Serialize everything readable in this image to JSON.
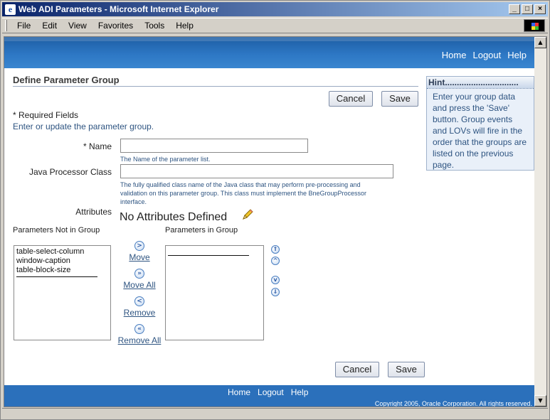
{
  "window": {
    "title": "Web ADI Parameters - Microsoft Internet Explorer",
    "controls": [
      "_",
      "□",
      "×"
    ]
  },
  "menu": [
    "File",
    "Edit",
    "View",
    "Favorites",
    "Tools",
    "Help"
  ],
  "global_links": [
    "Home",
    "Logout",
    "Help"
  ],
  "page": {
    "title": "Define Parameter Group",
    "cancel_label": "Cancel",
    "save_label": "Save",
    "required_note": "* Required Fields",
    "instruction": "Enter or update the parameter group."
  },
  "form": {
    "name_label": "* Name",
    "name_value": "",
    "name_tip": "The Name of the parameter list.",
    "java_label": "Java Processor Class",
    "java_value": "",
    "java_tip_1": "The fully qualified class name of the Java class that may perform pre-processing and",
    "java_tip_2": "validation on this parameter group. This class must implement the BneGroupProcessor",
    "java_tip_3": "interface.",
    "attributes_label": "Attributes",
    "no_attributes": "No Attributes Defined"
  },
  "shuttle": {
    "left_label": "Parameters Not in Group",
    "right_label": "Parameters in Group",
    "left_items": [
      "table-select-column",
      "window-caption",
      "table-block-size"
    ],
    "move": "Move",
    "move_all": "Move All",
    "remove": "Remove",
    "remove_all": "Remove All"
  },
  "hint": {
    "title": "Hint",
    "text": "Enter your group data and press the 'Save' button. Group events and LOVs will fire in the order that the groups are listed on the previous page."
  },
  "footer": {
    "links": [
      "Home",
      "Logout",
      "Help"
    ],
    "copyright": "Copyright 2005, Oracle Corporation. All rights reserved."
  },
  "colors": {
    "banner": "#2b70bb",
    "link": "#2e5481",
    "titlebar": "#0a246a"
  }
}
